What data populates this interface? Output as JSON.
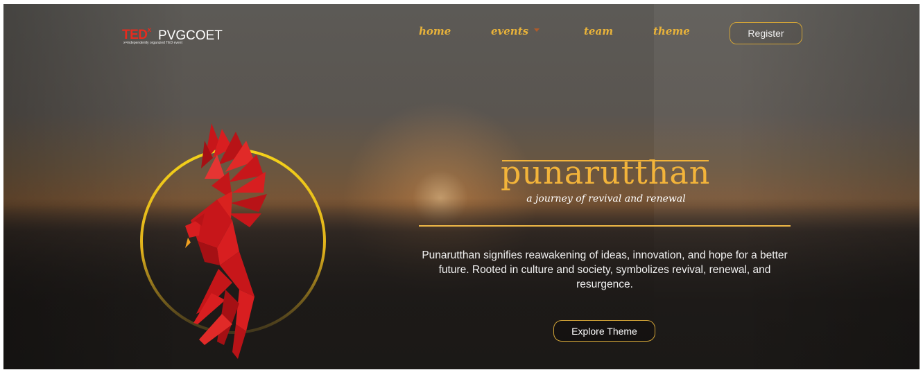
{
  "header": {
    "logo": {
      "brand": "TED",
      "x_mark": "x",
      "org": "PVGCOET",
      "tagline": "x=independently organized TED event"
    },
    "nav": [
      {
        "label": "home"
      },
      {
        "label": "events"
      },
      {
        "label": "team"
      },
      {
        "label": "theme"
      }
    ],
    "register_label": "Register"
  },
  "hero": {
    "title": "punarutthan",
    "subtitle": "a journey of revival and renewal",
    "description": "Punarutthan signifies reawakening of ideas, innovation, and hope for a better future. Rooted in culture and society, symbolizes revival, renewal, and resurgence.",
    "cta_label": "Explore Theme",
    "art": "phoenix-in-golden-ring"
  },
  "colors": {
    "accent": "#f3b43a",
    "brand_red": "#e62b1e",
    "phoenix_red": "#c7161a"
  }
}
